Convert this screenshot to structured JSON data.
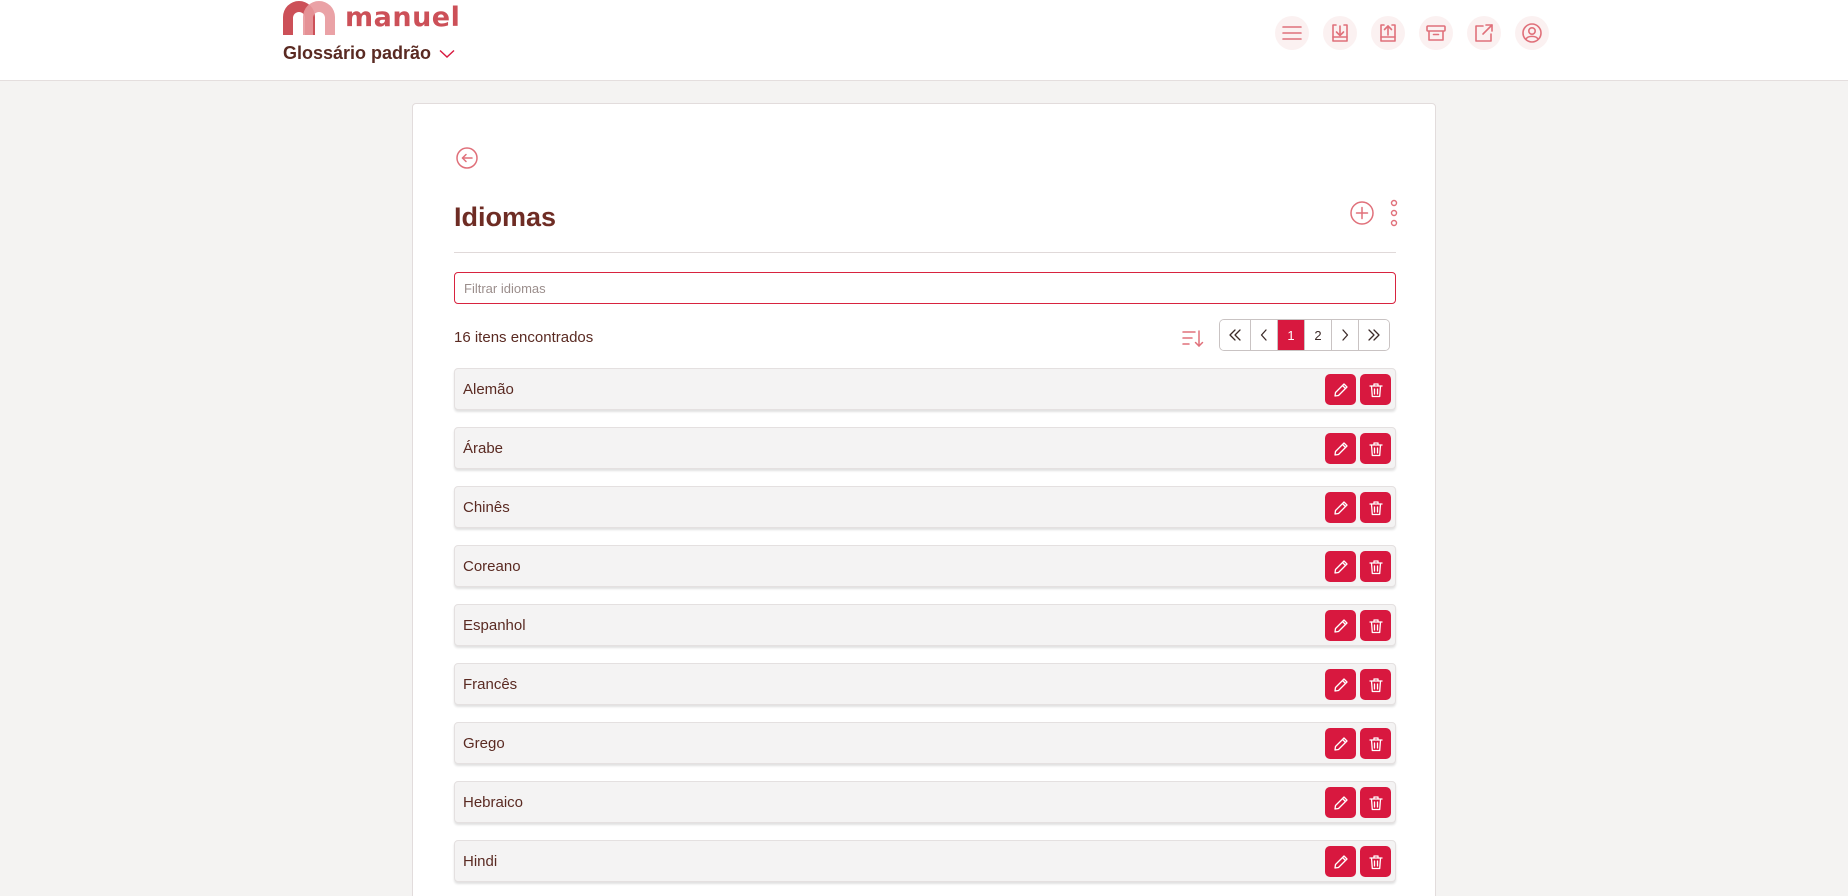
{
  "brand": {
    "name": "manuel",
    "accent": "#d8183f",
    "logo_color": "#cc5058"
  },
  "header": {
    "glossary_label": "Glossário padrão",
    "icons": [
      "menu-icon",
      "download-icon",
      "upload-icon",
      "archive-icon",
      "external-link-icon",
      "user-icon"
    ]
  },
  "page": {
    "title": "Idiomas",
    "filter_placeholder": "Filtrar idiomas",
    "count_text": "16 itens encontrados",
    "pagination": {
      "pages": [
        "1",
        "2"
      ],
      "current": "1"
    }
  },
  "items": [
    {
      "label": "Alemão"
    },
    {
      "label": "Árabe"
    },
    {
      "label": "Chinês"
    },
    {
      "label": "Coreano"
    },
    {
      "label": "Espanhol"
    },
    {
      "label": "Francês"
    },
    {
      "label": "Grego"
    },
    {
      "label": "Hebraico"
    },
    {
      "label": "Hindi"
    }
  ]
}
